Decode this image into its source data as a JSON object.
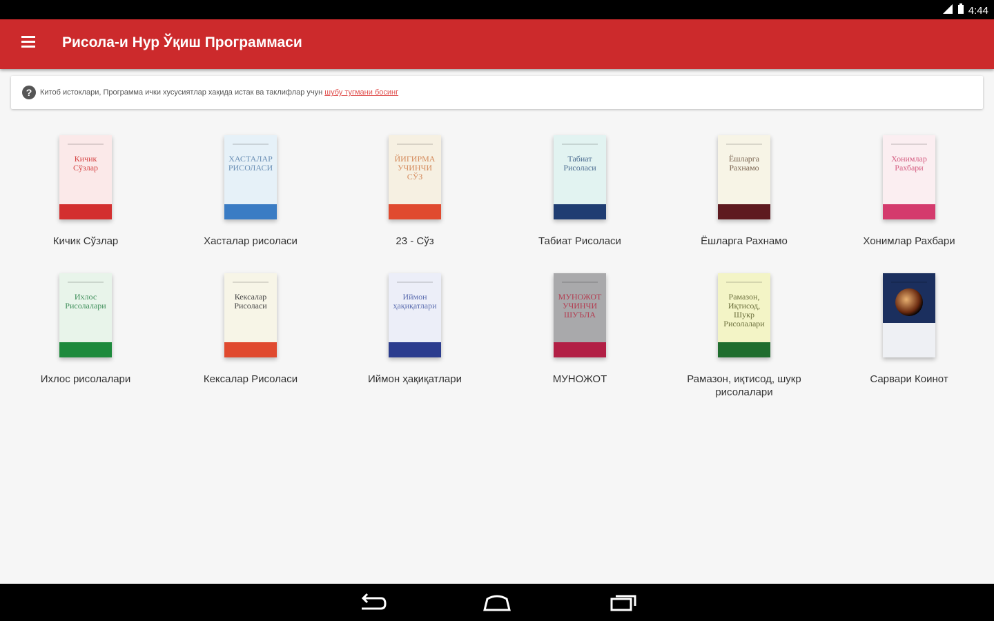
{
  "status_bar": {
    "time": "4:44"
  },
  "app_bar": {
    "title": "Рисола-и Нур Ўқиш Программаси"
  },
  "info_card": {
    "text": "Китоб истоклари, Программа ички хусусиятлар хақида истак ва таклифлар учун",
    "link": "шубу тугмани босинг"
  },
  "books": [
    {
      "title": "Кичик Сўзлар",
      "cover_text": "Кичик Сўзлар",
      "cover_color": "#fbe9e9",
      "band_color": "#d32f2f",
      "text_color": "#d64545"
    },
    {
      "title": "Хасталар рисоласи",
      "cover_text": "ХАСТАЛАР РИСОЛАСИ",
      "cover_color": "#e6f1f8",
      "band_color": "#3a7cc4",
      "text_color": "#6a8fb5"
    },
    {
      "title": "23 - Сўз",
      "cover_text": "ЙИГИРМА УЧИНЧИ СЎЗ",
      "cover_color": "#f6f0e2",
      "band_color": "#e04a2f",
      "text_color": "#d48a5b"
    },
    {
      "title": "Табиат Рисоласи",
      "cover_text": "Табиат Рисоласи",
      "cover_color": "#e2f3f1",
      "band_color": "#1f3d72",
      "text_color": "#4a6b8f"
    },
    {
      "title": "Ёшларга Рахнамо",
      "cover_text": "Ёшларга Рахнамо",
      "cover_color": "#f7f4e6",
      "band_color": "#5e1a1f",
      "text_color": "#7a6450"
    },
    {
      "title": "Хонимлар Рахбари",
      "cover_text": "Хонимлар Рахбари",
      "cover_color": "#fbeef1",
      "band_color": "#d43a6d",
      "text_color": "#d45c80"
    },
    {
      "title": "Ихлос рисолалари",
      "cover_text": "Ихлос Рисолалари",
      "cover_color": "#e8f4ea",
      "band_color": "#1d8a3c",
      "text_color": "#3f8f5a"
    },
    {
      "title": "Кексалар Рисоласи",
      "cover_text": "Кексалар Рисоласи",
      "cover_color": "#f7f5e7",
      "band_color": "#e04a2f",
      "text_color": "#444444"
    },
    {
      "title": "Иймон ҳақиқатлари",
      "cover_text": "Иймон ҳақиқатлари",
      "cover_color": "#eceef8",
      "band_color": "#2b3c8e",
      "text_color": "#5b6db0"
    },
    {
      "title": "МУНОЖОТ",
      "cover_text": "МУНОЖОТ УЧИНЧИ ШУЪЛА",
      "cover_color": "#a9a9ab",
      "band_color": "#b21f45",
      "text_color": "#b33b4f"
    },
    {
      "title": "Рамазон, иқтисод, шукр рисолалари",
      "cover_text": "Рамазон, Иқтисод, Шукр Рисолалари",
      "cover_color": "#f3f4c6",
      "band_color": "#1f6d2e",
      "text_color": "#6b6f3c"
    },
    {
      "title": "Сарвари Коинот",
      "cover_text": "",
      "cover_color": "#f0f2f5",
      "band_color": "#f0f2f5",
      "text_color": "#2a3e6e"
    }
  ]
}
